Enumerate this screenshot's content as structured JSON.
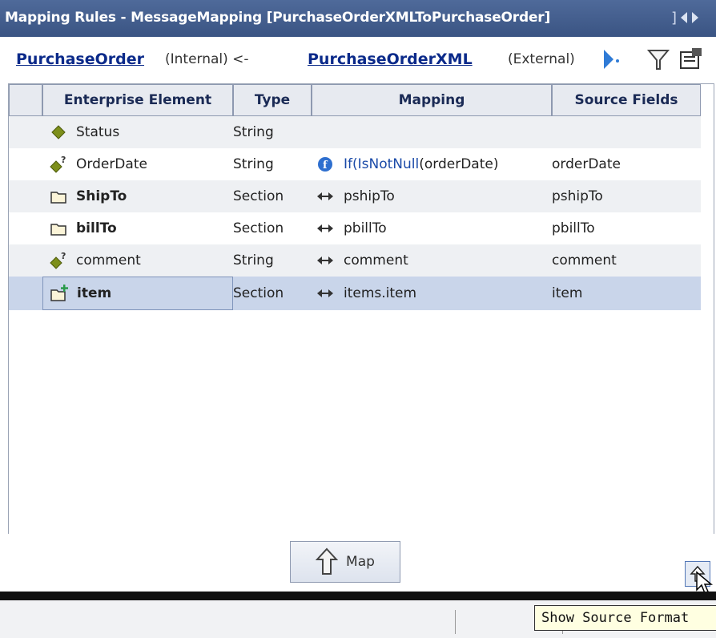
{
  "window": {
    "title": "Mapping Rules - MessageMapping [PurchaseOrderXMLToPurchaseOrder]",
    "title_icon": "swap-icon"
  },
  "header": {
    "target_link": "PurchaseOrder",
    "target_note": "(Internal) <-",
    "source_link": "PurchaseOrderXML",
    "source_note": "(External)",
    "icons": [
      "arrow-dropdown-icon",
      "filter-icon",
      "properties-icon"
    ]
  },
  "table": {
    "columns": [
      "Enterprise Element",
      "Type",
      "Mapping",
      "Source Fields"
    ],
    "rows": [
      {
        "element": "Status",
        "icon": "diamond-icon",
        "bold": false,
        "type": "String",
        "mapping_icon": "",
        "mapping": "",
        "source": ""
      },
      {
        "element": "OrderDate",
        "icon": "diamond-optional-icon",
        "bold": false,
        "type": "String",
        "mapping_icon": "function-icon",
        "mapping_fn": "If(",
        "mapping_fn2": "IsNotNull",
        "mapping_rest": "(orderDate)",
        "source": "orderDate"
      },
      {
        "element": "ShipTo",
        "icon": "folder-icon",
        "bold": true,
        "type": "Section",
        "mapping_icon": "direct-map-icon",
        "mapping": "pshipTo",
        "source": "pshipTo"
      },
      {
        "element": "billTo",
        "icon": "folder-icon",
        "bold": true,
        "type": "Section",
        "mapping_icon": "direct-map-icon",
        "mapping": "pbillTo",
        "source": "pbillTo"
      },
      {
        "element": "comment",
        "icon": "diamond-optional-icon",
        "bold": false,
        "type": "String",
        "mapping_icon": "direct-map-icon",
        "mapping": "comment",
        "source": "comment"
      },
      {
        "element": "item",
        "icon": "folder-add-icon",
        "bold": true,
        "type": "Section",
        "mapping_icon": "direct-map-icon",
        "mapping": "items.item",
        "source": "item",
        "selected": true
      }
    ]
  },
  "footer": {
    "map_button": "Map",
    "map_icon": "up-arrow-icon",
    "source_format_button_icon": "up-arrow-icon"
  },
  "tooltip": "Show Source Format"
}
